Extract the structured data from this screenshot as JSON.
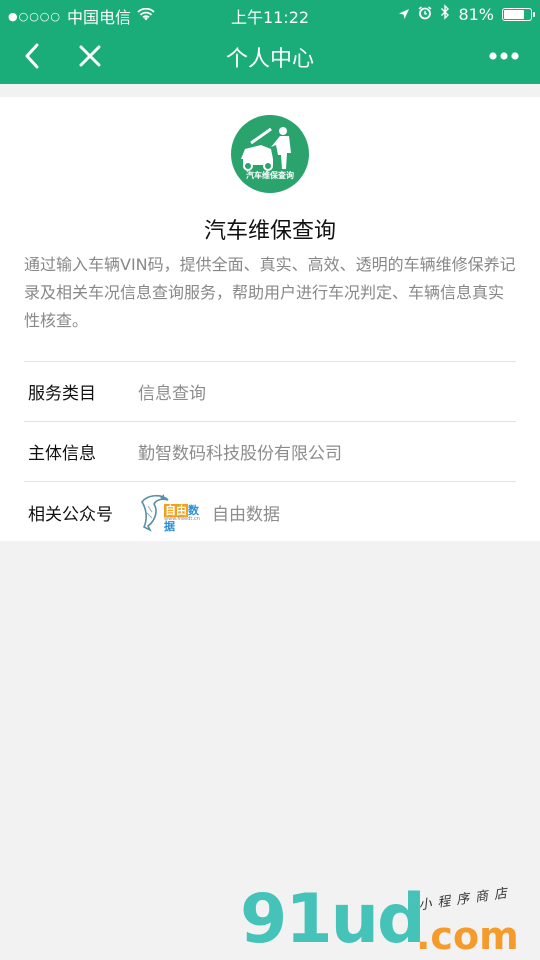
{
  "status_bar": {
    "signal_dots": "●○○○○",
    "carrier": "中国电信",
    "time": "上午11:22",
    "battery_percent": "81%",
    "battery_level": 0.81
  },
  "nav": {
    "title": "个人中心"
  },
  "app": {
    "logo_text": "汽车维保查询",
    "name": "汽车维保查询",
    "description": "通过输入车辆VIN码，提供全面、真实、高效、透明的车辆维修保养记录及相关车况信息查询服务，帮助用户进行车况判定、车辆信息真实性核查。"
  },
  "info": {
    "service_category_label": "服务类目",
    "service_category_value": "信息查询",
    "entity_label": "主体信息",
    "entity_value": "勤智数码科技股份有限公司",
    "account_label": "相关公众号",
    "account_logo_text_a": "自由",
    "account_logo_text_b": "数据",
    "account_logo_url": "www.freedt.cn",
    "account_name": "自由数据"
  },
  "watermark": {
    "brand": "91ud",
    "domain": ".com",
    "tagline": "小程序商店"
  },
  "colors": {
    "brand_green": "#1aad7a",
    "logo_green": "#2aa36c",
    "watermark_teal": "#45c3b8",
    "watermark_orange": "#f49b2c"
  },
  "icons": {
    "back": "chevron-left-icon",
    "close": "close-icon",
    "more": "more-dots-icon",
    "wifi": "wifi-icon",
    "location": "location-arrow-icon",
    "alarm": "alarm-icon",
    "bluetooth": "bluetooth-icon",
    "battery": "battery-icon"
  }
}
